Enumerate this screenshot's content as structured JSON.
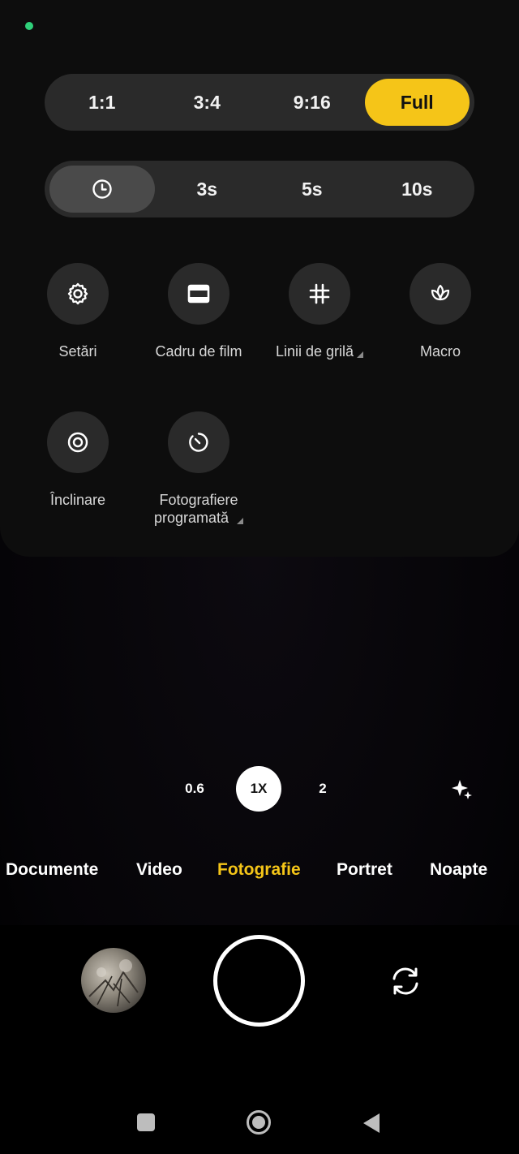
{
  "aspect_ratio": {
    "options": [
      "1:1",
      "3:4",
      "9:16",
      "Full"
    ],
    "selected": "Full"
  },
  "timer": {
    "options": [
      "3s",
      "5s",
      "10s"
    ],
    "selected_icon": "clock-icon"
  },
  "tiles": {
    "settings": {
      "label": "Setări",
      "icon": "gear-icon"
    },
    "movie_frame": {
      "label": "Cadru de film",
      "icon": "movie-frame-icon"
    },
    "grid_lines": {
      "label": "Linii de grilă",
      "icon": "grid-icon"
    },
    "macro": {
      "label": "Macro",
      "icon": "macro-flower-icon"
    },
    "tilt": {
      "label": "Înclinare",
      "icon": "tilt-shift-icon"
    },
    "timed_burst": {
      "label_line1": "Fotografiere",
      "label_line2": "programată",
      "icon": "timed-shot-icon"
    }
  },
  "zoom": {
    "options": [
      "0.6",
      "1X",
      "2"
    ],
    "selected": "1X"
  },
  "modes": {
    "items": [
      "Documente",
      "Video",
      "Fotografie",
      "Portret",
      "Noapte"
    ],
    "selected": "Fotografie"
  },
  "colors": {
    "accent": "#f5c518",
    "status_dot": "#2fd07a"
  }
}
